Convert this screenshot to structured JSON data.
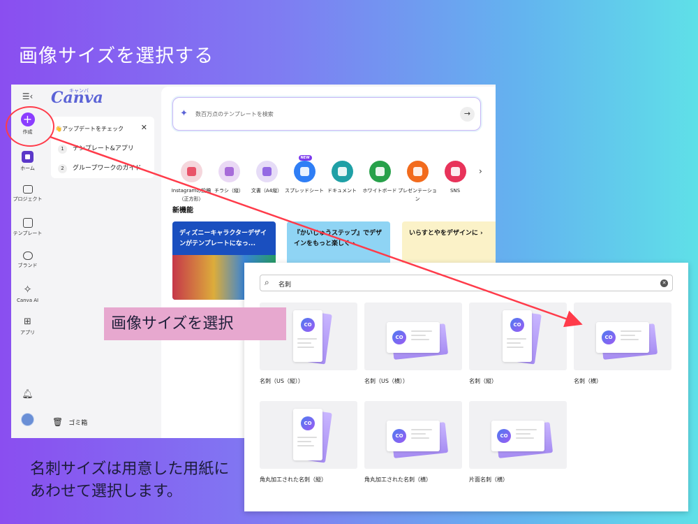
{
  "slide": {
    "title": "画像サイズを選択する",
    "caption_line1": "名刺サイズは用意した用紙に",
    "caption_line2": "あわせて選択します。",
    "annotation_label": "画像サイズを選択"
  },
  "rail": {
    "menu_icon": "menu-collapse-icon",
    "create_label": "作成",
    "home_label": "ホーム",
    "projects_label": "プロジェクト",
    "templates_label": "テンプレート",
    "brand_label": "ブランド",
    "canva_ai_label": "Canva AI",
    "apps_label": "アプリ"
  },
  "side_panel": {
    "logo": "Canva",
    "logo_kana": "キャンバ",
    "update_title": "👋アップデートをチェック",
    "update_items": [
      {
        "num": "1",
        "label": "テンプレート&アプリ"
      },
      {
        "num": "2",
        "label": "グループワークのガイド"
      }
    ],
    "trash_label": "ゴミ箱"
  },
  "main": {
    "search_placeholder": "数百万点のテンプレートを検索",
    "categories": [
      {
        "label": "Instagramの投稿（正方形）",
        "color": "#f5d6dc",
        "inner": "#e8455c"
      },
      {
        "label": "チラシ（縦）",
        "color": "#ead9f5",
        "inner": "#a05fd6"
      },
      {
        "label": "文書（A4縦）",
        "color": "#e6dcf7",
        "inner": "#8a5ce0"
      },
      {
        "label": "スプレッドシート",
        "color": "#2f7ef5",
        "inner": "#ffffff",
        "badge": "NEW"
      },
      {
        "label": "ドキュメント",
        "color": "#1fa0a6",
        "inner": "#ffffff"
      },
      {
        "label": "ホワイトボード",
        "color": "#27a14a",
        "inner": "#ffffff"
      },
      {
        "label": "プレゼンテーション",
        "color": "#f26b1d",
        "inner": "#ffffff"
      },
      {
        "label": "SNS",
        "color": "#e8335a",
        "inner": "#ffffff"
      }
    ],
    "section_title": "新機能",
    "features": [
      {
        "text": "ディズニーキャラクターデザインがテンプレートになっ...",
        "bg": "#1a4fbf",
        "fg": "#ffffff"
      },
      {
        "text": "『かいじゅうステップ』でデザインをもっと楽しく ›",
        "bg": "#8fd4f4",
        "fg": "#111111"
      },
      {
        "text": "いらすとやをデザインに ›",
        "bg": "#fbf2c8",
        "fg": "#111111"
      }
    ]
  },
  "dialog": {
    "search_value": "名刺",
    "templates": [
      {
        "label": "名刺（US（縦））",
        "orientation": "vertical"
      },
      {
        "label": "名刺（US（横））",
        "orientation": "horizontal"
      },
      {
        "label": "名刺（縦）",
        "orientation": "vertical"
      },
      {
        "label": "名刺（横）",
        "orientation": "horizontal"
      },
      {
        "label": "角丸加工された名刺（縦）",
        "orientation": "vertical"
      },
      {
        "label": "角丸加工された名刺（横）",
        "orientation": "horizontal"
      },
      {
        "label": "片面名刺（横）",
        "orientation": "horizontal"
      }
    ],
    "logo_text": "CO"
  },
  "colors": {
    "accent": "#8b3dff",
    "annotation_red": "#ff3b4a",
    "label_pink": "#e7a8cf"
  }
}
